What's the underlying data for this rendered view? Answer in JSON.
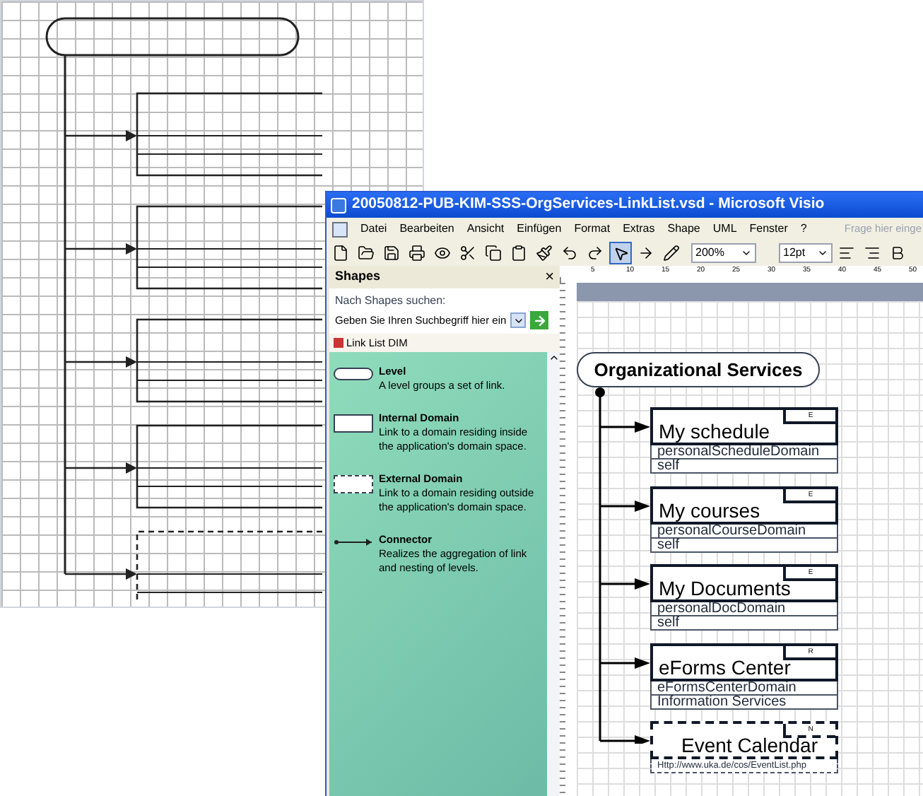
{
  "window": {
    "title": "20050812-PUB-KIM-SSS-OrgServices-LinkList.vsd - Microsoft Visio"
  },
  "menu": [
    "Datei",
    "Bearbeiten",
    "Ansicht",
    "Einfügen",
    "Format",
    "Extras",
    "Shape",
    "UML",
    "Fenster",
    "?"
  ],
  "help_field": {
    "placeholder": "Frage hier einge"
  },
  "toolbar": {
    "zoom": "200%",
    "font_size": "12pt"
  },
  "shapes_panel": {
    "title": "Shapes",
    "close": "×",
    "search_label": "Nach Shapes suchen:",
    "search_value": "Geben Sie Ihren Suchbegriff hier ein",
    "stencil": "Link List DIM",
    "items": [
      {
        "kind": "level",
        "name": "Level",
        "description": "A level groups a set of link."
      },
      {
        "kind": "internal",
        "name": "Internal Domain",
        "description": "Link to a domain residing inside the application's domain space."
      },
      {
        "kind": "external",
        "name": "External Domain",
        "description": "Link to a domain residing outside the application's domain space."
      },
      {
        "kind": "connector",
        "name": "Connector",
        "description": "Realizes the aggregation of link and nesting of levels."
      }
    ]
  },
  "ruler": [
    "5",
    "10",
    "15",
    "20",
    "25",
    "30",
    "35",
    "40",
    "45",
    "50"
  ],
  "diagram": {
    "level": "Organizational Services",
    "nodes": [
      {
        "kind": "internal",
        "title": "My schedule",
        "badge": "E",
        "rows": [
          "personalScheduleDomain",
          "self"
        ]
      },
      {
        "kind": "internal",
        "title": "My courses",
        "badge": "E",
        "rows": [
          "personalCourseDomain",
          "self"
        ]
      },
      {
        "kind": "internal",
        "title": "My Documents",
        "badge": "E",
        "rows": [
          "personalDocDomain",
          "self"
        ]
      },
      {
        "kind": "internal",
        "title": "eForms Center",
        "badge": "R",
        "rows": [
          "eFormsCenterDomain",
          "Information Services"
        ]
      },
      {
        "kind": "external",
        "title": "Event Calendar",
        "badge": "N",
        "rows": [
          "Http://www.uka.de/cos/EventList.php"
        ]
      }
    ]
  }
}
